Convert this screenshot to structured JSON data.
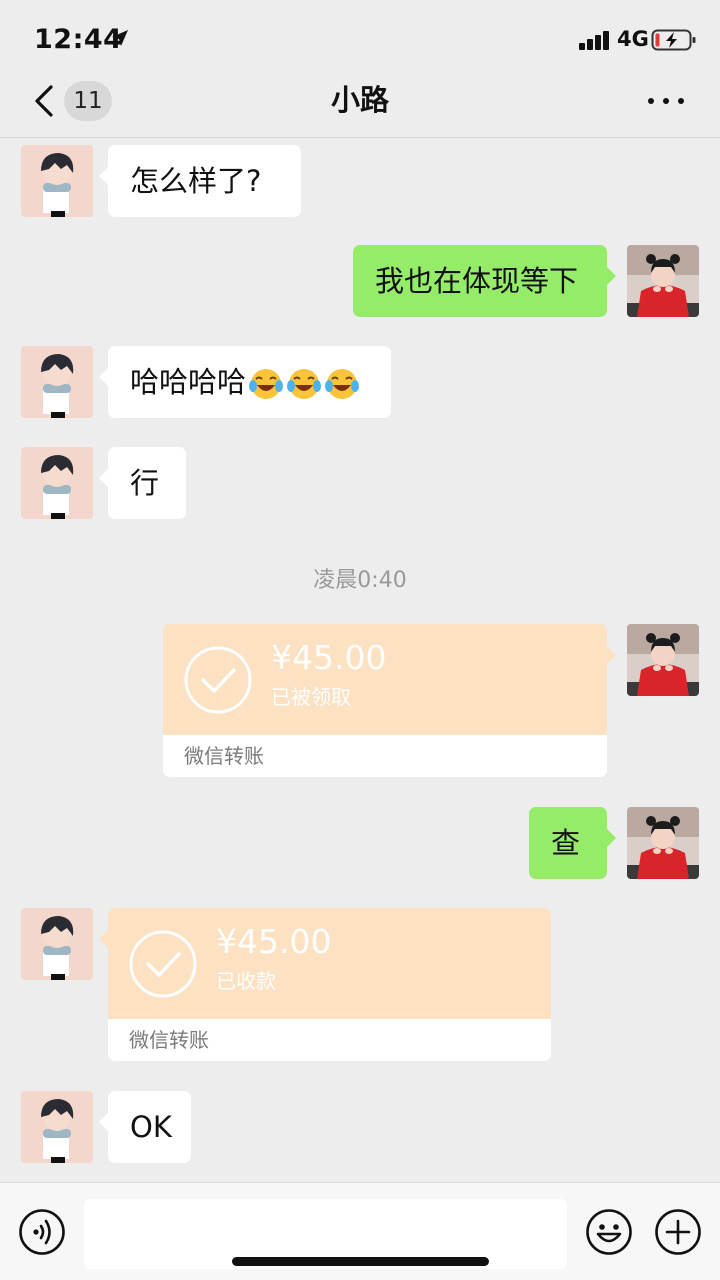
{
  "status_bar": {
    "time": "12:44",
    "network": "4G"
  },
  "nav": {
    "unread_count": "11",
    "title": "小路"
  },
  "messages": [
    {
      "side": "left",
      "text": "怎么样了?"
    },
    {
      "side": "right",
      "text": "我也在体现等下"
    },
    {
      "side": "left",
      "text": "哈哈哈哈",
      "emoji": [
        "face-with-tears-of-joy",
        "face-with-tears-of-joy",
        "face-with-tears-of-joy"
      ]
    },
    {
      "side": "left",
      "text": "行"
    },
    {
      "side": "right",
      "text": "查"
    },
    {
      "side": "left",
      "text": "OK"
    }
  ],
  "timestamp": "凌晨0:40",
  "transfers": [
    {
      "side": "right",
      "amount": "¥45.00",
      "status": "已被领取",
      "brand": "微信转账"
    },
    {
      "side": "left",
      "amount": "¥45.00",
      "status": "已收款",
      "brand": "微信转账"
    }
  ],
  "colors": {
    "self_bubble": "#95ec69",
    "other_bubble": "#ffffff",
    "transfer_card": "#fde1c3",
    "background": "#ededed"
  },
  "input_bar": {
    "message_input": ""
  }
}
